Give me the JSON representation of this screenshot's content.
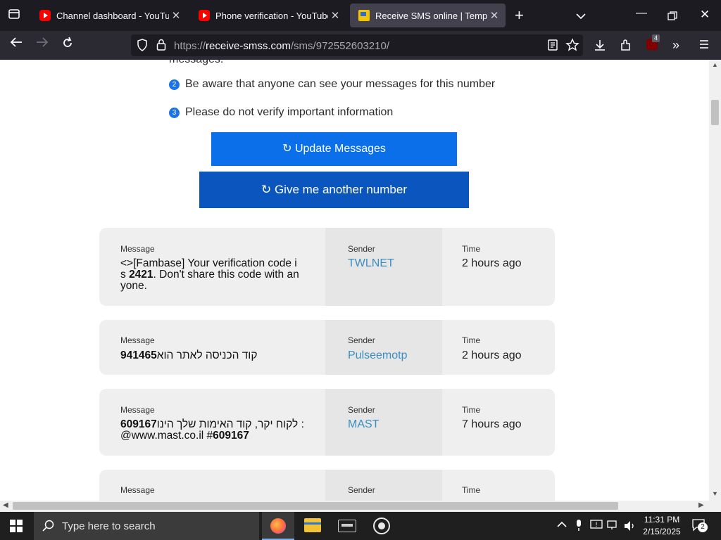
{
  "browser": {
    "tabs": [
      {
        "title": "Channel dashboard - YouTube Studio",
        "icon": "youtube-icon"
      },
      {
        "title": "Phone verification - YouTube",
        "icon": "youtube-icon"
      },
      {
        "title": "Receive SMS online | Temporary",
        "icon": "sms-site-icon"
      }
    ],
    "url_prefix": "https://",
    "url_host": "receive-smss.com",
    "url_path": "/sms/972552603210/",
    "extension_badge": "4"
  },
  "page": {
    "partial_text": "messages.",
    "notes": [
      {
        "num": "2",
        "text": "Be aware that anyone can see your messages for this number"
      },
      {
        "num": "3",
        "text": "Please do not verify important information"
      }
    ],
    "update_button": "↻ Update Messages",
    "another_button": "↻ Give me another number",
    "labels": {
      "message": "Message",
      "sender": "Sender",
      "time": "Time"
    },
    "messages": [
      {
        "line1": "<>[Fambase] Your verification code i",
        "line2_pre": "s ",
        "line2_code": "2421",
        "line2_post": ". Don't share this code with an",
        "line3": "yone.",
        "sender": "TWLNET",
        "time": "2 hours ago"
      },
      {
        "code": "941465",
        "text": " קוד הכניסה לאתר הוא",
        "sender": "Pulseemotp",
        "time": "2 hours ago"
      },
      {
        "code": "609167",
        "text": ": לקוח יקר, קוד האימות שלך הינו",
        "line2_pre": "@www.mast.co.il #",
        "line2_code": "609167",
        "sender": "MAST",
        "time": "7 hours ago"
      }
    ]
  },
  "taskbar": {
    "search_placeholder": "Type here to search",
    "time": "11:31 PM",
    "date": "2/15/2025",
    "notifications": "2"
  },
  "colors": {
    "primary_button": "#0a6fe8",
    "secondary_button": "#0a56be",
    "sender_link": "#3a8fbf"
  }
}
